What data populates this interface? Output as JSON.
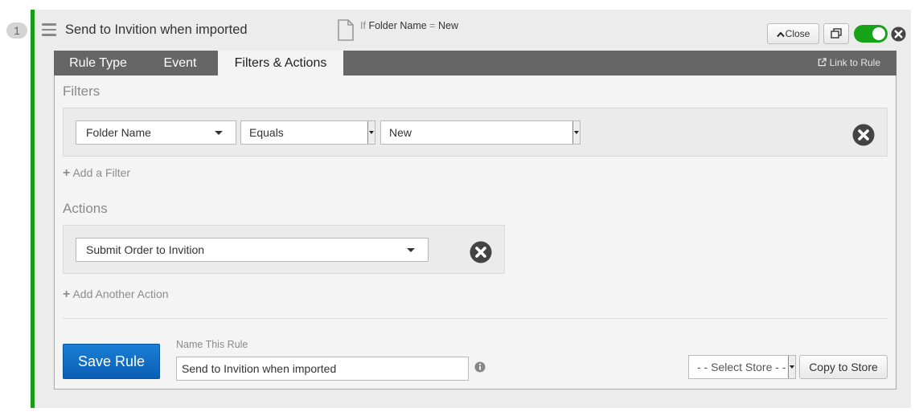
{
  "rule": {
    "number": "1",
    "title": "Send to Invition when imported",
    "enabled": true,
    "summary": {
      "if_label": "If",
      "field": "Folder Name",
      "operator": "=",
      "value": "New"
    },
    "close_label": "Close"
  },
  "tabs": [
    {
      "label": "Rule Type",
      "active": false
    },
    {
      "label": "Event",
      "active": false
    },
    {
      "label": "Filters & Actions",
      "active": true
    }
  ],
  "link_to_rule": "Link to Rule",
  "filters": {
    "title": "Filters",
    "items": [
      {
        "field": "Folder Name",
        "operator": "Equals",
        "value": "New"
      }
    ],
    "add_label": "Add a Filter"
  },
  "actions": {
    "title": "Actions",
    "items": [
      {
        "action": "Submit Order to Invition"
      }
    ],
    "add_label": "Add Another Action"
  },
  "footer": {
    "save_label": "Save Rule",
    "name_label": "Name This Rule",
    "name_value": "Send to Invition when imported",
    "store_select": "- - Select Store - -",
    "copy_label": "Copy to Store"
  },
  "colors": {
    "accent_green": "#1a9c1a",
    "toggle_green": "#17a317",
    "tab_bar": "#666666",
    "save_blue": "#0a6cc7"
  },
  "icons": [
    "hamburger-icon",
    "document-icon",
    "chevron-up-icon",
    "copy-icon",
    "close-circle-icon",
    "external-link-icon",
    "plus-icon",
    "info-icon",
    "dropdown-caret-icon"
  ]
}
